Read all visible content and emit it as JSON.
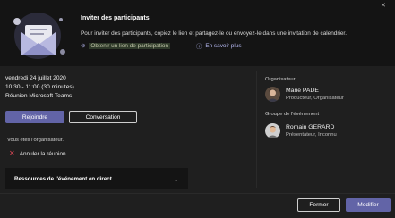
{
  "banner": {
    "title": "Inviter des participants",
    "description": "Pour inviter des participants, copiez le lien et partagez-le ou envoyez-le dans une invitation de calendrier.",
    "get_link_label": "Obtenir un lien de participation",
    "learn_more_label": "En savoir plus",
    "close_icon": "close-icon"
  },
  "meeting": {
    "date": "vendredi 24 juillet 2020",
    "time": "10:30 - 11:00 (30 minutes)",
    "type": "Réunion Microsoft Teams"
  },
  "actions": {
    "join_label": "Rejoindre",
    "conversation_label": "Conversation"
  },
  "organizer_note": "Vous êtes l'organisateur.",
  "cancel_label": "Annuler la réunion",
  "resources": {
    "label": "Ressources de l'événement en direct"
  },
  "people": {
    "organizer_heading": "Organisateur",
    "organizer": {
      "name": "Marie PADE",
      "role": "Producteur, Organisateur"
    },
    "group_heading": "Groupe de l'événement",
    "member": {
      "name": "Romain GERARD",
      "role": "Présentateur, Inconnu"
    }
  },
  "footer": {
    "close_label": "Fermer",
    "edit_label": "Modifier"
  },
  "colors": {
    "accent": "#6264a7",
    "background": "#1f1f1f",
    "banner": "#141414",
    "link": "#b3b6ee",
    "danger": "#d74654"
  }
}
